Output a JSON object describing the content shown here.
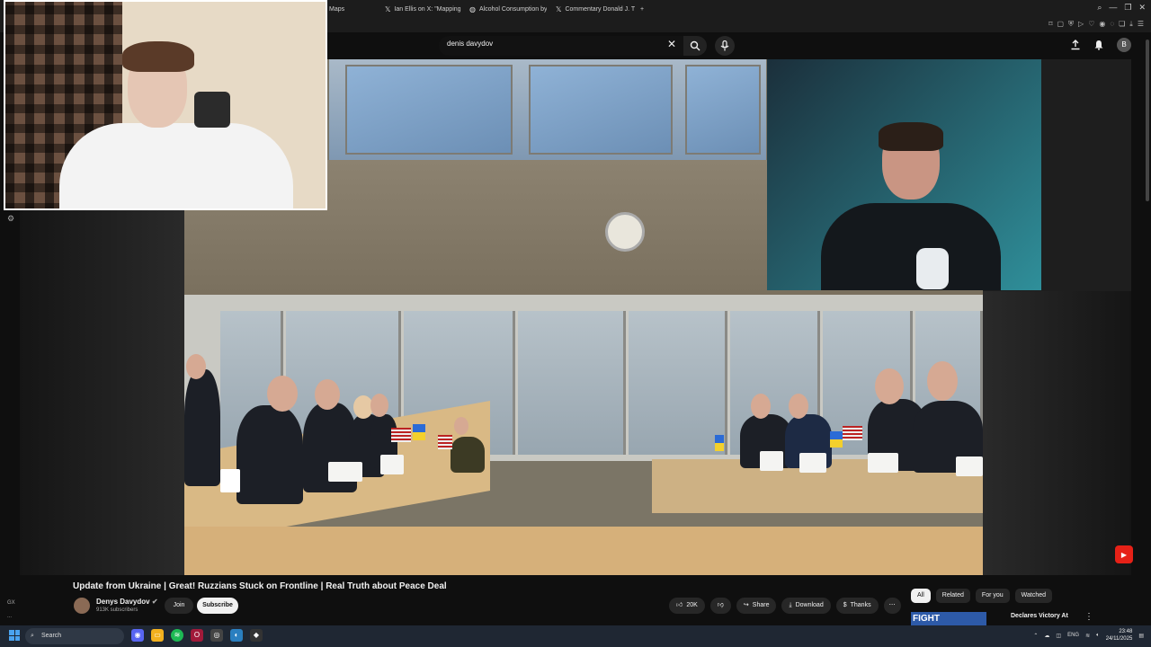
{
  "browser": {
    "tabs": [
      {
        "label": "Maps",
        "icon": "maps-icon"
      },
      {
        "label": "Ian Ellis on X: \"Mapping i",
        "icon": "x-logo-icon"
      },
      {
        "label": "Alcohol Consumption by",
        "icon": "globe-icon"
      },
      {
        "label": "Commentary Donald J. Tr",
        "icon": "x-logo-icon"
      }
    ],
    "new_tab_label": "+",
    "window_controls": [
      "⌕",
      "—",
      "❐",
      "✕"
    ]
  },
  "youtube": {
    "search_value": "denis davydov",
    "account_initial": "B"
  },
  "video": {
    "title": "Update from Ukraine | Great! Ruzzians Stuck on Frontline | Real Truth about Peace Deal",
    "channel_name": "Denys Davydov",
    "subscribers": "913K subscribers",
    "join_label": "Join",
    "subscribe_label": "Subscribe",
    "likes": "20K",
    "share_label": "Share",
    "download_label": "Download",
    "thanks_label": "Thanks"
  },
  "chips": [
    "All",
    "Related",
    "For you",
    "Watched"
  ],
  "recommendation": {
    "thumb_text": "FIGHT",
    "title": "Declares Victory At"
  },
  "sidebar_labels": {
    "gx": "GX",
    "dots": "..."
  },
  "taskbar": {
    "search_placeholder": "Search",
    "language": "ENG",
    "time": "23:48",
    "date": "24/11/2025"
  },
  "colors": {
    "accent_red": "#e62117",
    "background": "#0f0f0f",
    "taskbar": "#1f2733"
  }
}
